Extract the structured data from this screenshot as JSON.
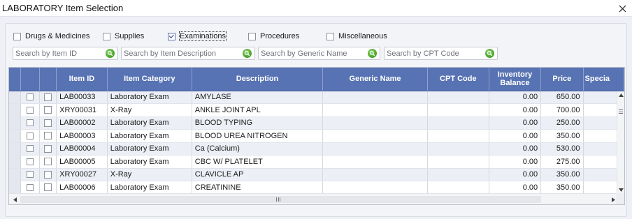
{
  "window": {
    "title": "LABORATORY Item Selection"
  },
  "filters": [
    {
      "label": "Drugs & Medicines",
      "checked": false
    },
    {
      "label": "Supplies",
      "checked": false
    },
    {
      "label": "Examinations",
      "checked": true
    },
    {
      "label": "Procedures",
      "checked": false
    },
    {
      "label": "Miscellaneous",
      "checked": false
    }
  ],
  "search": {
    "item_id": {
      "placeholder": "Search by Item ID"
    },
    "description": {
      "placeholder": "Search by Item Description"
    },
    "generic": {
      "placeholder": "Search by Generic Name"
    },
    "cpt": {
      "placeholder": "Search by CPT Code"
    }
  },
  "table": {
    "columns": {
      "item_id": "Item ID",
      "category": "Item Category",
      "description": "Description",
      "generic": "Generic Name",
      "cpt": "CPT Code",
      "inventory_1": "Inventory",
      "inventory_2": "Balance",
      "price": "Price",
      "special": "Specia"
    },
    "rows": [
      {
        "item_id": "LAB00033",
        "category": "Laboratory Exam",
        "description": "AMYLASE",
        "generic": "",
        "cpt": "",
        "inventory": "0.00",
        "price": "650.00"
      },
      {
        "item_id": "XRY00031",
        "category": "X-Ray",
        "description": "ANKLE JOINT APL",
        "generic": "",
        "cpt": "",
        "inventory": "0.00",
        "price": "700.00"
      },
      {
        "item_id": "LAB00002",
        "category": "Laboratory Exam",
        "description": "BLOOD TYPING",
        "generic": "",
        "cpt": "",
        "inventory": "0.00",
        "price": "250.00"
      },
      {
        "item_id": "LAB00003",
        "category": "Laboratory Exam",
        "description": "BLOOD UREA NITROGEN",
        "generic": "",
        "cpt": "",
        "inventory": "0.00",
        "price": "350.00"
      },
      {
        "item_id": "LAB00004",
        "category": "Laboratory Exam",
        "description": "Ca (Calcium)",
        "generic": "",
        "cpt": "",
        "inventory": "0.00",
        "price": "530.00"
      },
      {
        "item_id": "LAB00005",
        "category": "Laboratory Exam",
        "description": "CBC W/ PLATELET",
        "generic": "",
        "cpt": "",
        "inventory": "0.00",
        "price": "275.00"
      },
      {
        "item_id": "XRY00027",
        "category": "X-Ray",
        "description": "CLAVICLE AP",
        "generic": "",
        "cpt": "",
        "inventory": "0.00",
        "price": "350.00"
      },
      {
        "item_id": "LAB00006",
        "category": "Laboratory Exam",
        "description": "CREATININE",
        "generic": "",
        "cpt": "",
        "inventory": "0.00",
        "price": "350.00"
      }
    ]
  },
  "icons": {
    "close": "close-icon",
    "search": "search-icon",
    "scroll_up": "arrow-up-icon",
    "scroll_down": "arrow-down-icon",
    "scroll_left": "arrow-left-icon",
    "scroll_right": "arrow-right-icon"
  },
  "colors": {
    "header_bg": "#5873b3",
    "row_alt": "#eceff5",
    "search_button": "#4ea82e"
  }
}
